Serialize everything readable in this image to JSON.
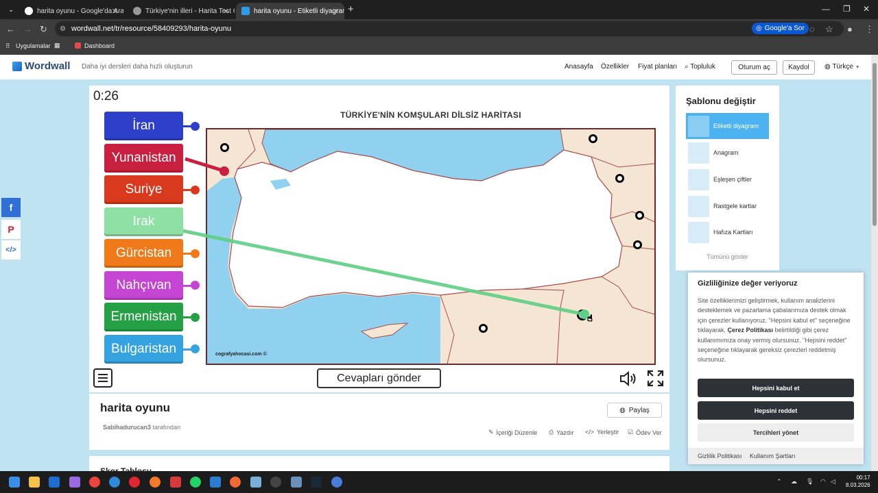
{
  "browser": {
    "tabs": [
      {
        "label": "harita oyunu - Google'da Ara",
        "color": "#4285f4"
      },
      {
        "label": "Türkiye'nin illeri - Harita Test O...",
        "color": "#888888"
      },
      {
        "label": "harita oyunu - Etiketli diyagram",
        "color": "#2f9be0"
      }
    ],
    "url": "wordwall.net/tr/resource/58409293/harita-oyunu",
    "google_sor": "Google'a Sor",
    "bookmarks": {
      "apps": "Uygulamalar",
      "dashboard": "Dashboard"
    }
  },
  "site": {
    "logo": "Wordwall",
    "tagline": "Daha iyi dersleri daha hızlı oluşturun",
    "nav": {
      "home": "Anasayfa",
      "features": "Özellikler",
      "pricing": "Fiyat planları",
      "community": "Topluluk"
    },
    "login": "Oturum aç",
    "signup": "Kaydol",
    "language": "Türkçe"
  },
  "game": {
    "timer": "0:26",
    "map_title": "TÜRKİYE'NİN KOMŞULARI DİLSİZ HARİTASI",
    "map_credit": "cografyahocasi.com ©",
    "labels": [
      {
        "text": "İran",
        "color": "#2e3fc9"
      },
      {
        "text": "Yunanistan",
        "color": "#c8203e"
      },
      {
        "text": "Suriye",
        "color": "#d93a1e"
      },
      {
        "text": "Irak",
        "color": "#8fe0a4"
      },
      {
        "text": "Gürcistan",
        "color": "#f07a1a"
      },
      {
        "text": "Nahçıvan",
        "color": "#c445d2"
      },
      {
        "text": "Ermenistan",
        "color": "#26a044"
      },
      {
        "text": "Bulgaristan",
        "color": "#35a3e0"
      }
    ],
    "submit": "Cevapları gönder"
  },
  "activity": {
    "title": "harita oyunu",
    "author": "Sabihadurucan3",
    "author_suffix": "tarafından",
    "share": "Paylaş",
    "actions": {
      "edit": "İçeriği Düzenle",
      "print": "Yazdır",
      "embed": "Yerleştir",
      "assign": "Ödev Ver"
    },
    "next_section": "Skor Tablosu"
  },
  "templates": {
    "heading": "Şablonu değiştir",
    "items": [
      "Etiketli diyagram",
      "Anagram",
      "Eşleşen çiftler",
      "Rastgele kartlar",
      "Hafıza Kartları"
    ],
    "show_all": "Tümünü göster"
  },
  "cookie": {
    "title": "Gizliliğinize değer veriyoruz",
    "text_1": "Site özelliklerimizi geliştirmek, kullanım analizlerini desteklemek ve pazarlama çabalarımıza destek olmak için çerezler kullanıyoruz. \"Hepsini kabul et\" seçeneğine tıklayarak,",
    "policy_link": "Çerez Politikası",
    "text_2": "belirtildiği gibi çerez kullanımımıza onay vermiş olursunuz. \"Hepsini reddet\" seçeneğine tıklayarak gereksiz çerezleri reddetmiş olursunuz.",
    "accept": "Hepsini kabul et",
    "reject": "Hepsini reddet",
    "manage": "Tercihleri yönet",
    "privacy": "Gizlilik Politikası",
    "terms": "Kullanım Şartları"
  },
  "taskbar": {
    "time": "00:17",
    "date": "8.03.2026"
  },
  "colors": {
    "sea": "#8fd1ee",
    "land": "#ffffff",
    "neighbors": "#f5e6d3",
    "border": "#a84a4a",
    "accent": "#2f9be0"
  }
}
